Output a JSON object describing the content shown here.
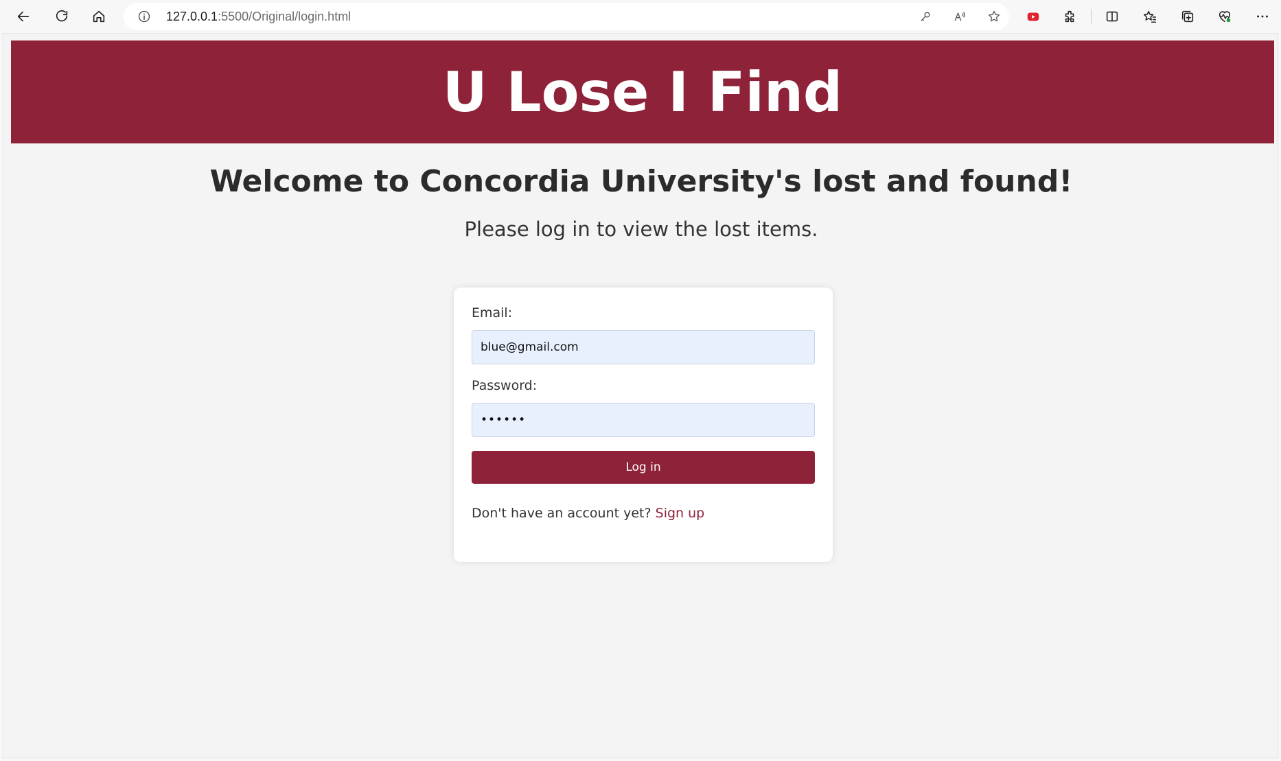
{
  "browser": {
    "url_host": "127.0.0.1",
    "url_rest": ":5500/Original/login.html",
    "icons": [
      "back-arrow-icon",
      "refresh-icon",
      "home-icon",
      "info-icon",
      "key-icon",
      "read-aloud-icon",
      "star-icon",
      "youtube-extension-icon",
      "extensions-icon",
      "split-screen-icon",
      "favorites-icon",
      "collections-icon",
      "browser-essentials-icon",
      "more-icon"
    ]
  },
  "banner": {
    "title": "U Lose I Find",
    "color": "#8e2238"
  },
  "welcome": "Welcome to Concordia University's lost and found!",
  "subtitle": "Please log in to view the lost items.",
  "form": {
    "email_label": "Email:",
    "email_value": "blue@gmail.com",
    "password_label": "Password:",
    "password_value": "••••••",
    "login_label": "Log in",
    "no_account_text": "Don't have an account yet?",
    "signup_label": "Sign up"
  }
}
